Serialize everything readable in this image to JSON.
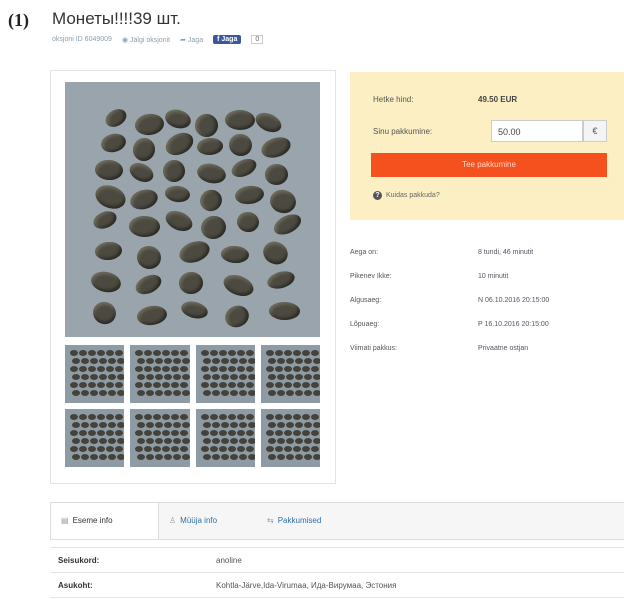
{
  "figure_label": "(1)",
  "listing": {
    "title": "Монеты!!!!39 шт.",
    "meta": {
      "item_id": "oksjoni ID 6049009",
      "watch": "Jälgi oksjonit",
      "share": "Jaga",
      "fb_label": "Jaga",
      "fb_count": "0"
    }
  },
  "bid": {
    "current_price_label": "Hetke hind:",
    "current_price_value": "49.50 EUR",
    "your_bid_label": "Sinu pakkumine:",
    "your_bid_value": "50.00",
    "currency": "€",
    "bid_button": "Tee pakkumine",
    "how_link": "Kuidas pakkuda?"
  },
  "auction_info": [
    {
      "label": "Aega on:",
      "value": "8 tundi, 46 minutit"
    },
    {
      "label": "Pikenev Ikke:",
      "value": "10 minutit"
    },
    {
      "label": "Algusaeg:",
      "value": "N 06.10.2016 20:15:00"
    },
    {
      "label": "Lõpuaeg:",
      "value": "P 16.10.2016 20:15:00"
    },
    {
      "label": "Viimati pakkus:",
      "value": "Privaatne ostjan"
    }
  ],
  "tabs": [
    {
      "label": "Eseme info",
      "icon": "info-icon"
    },
    {
      "label": "Müüja info",
      "icon": "user-icon"
    },
    {
      "label": "Pakkumised",
      "icon": "bids-icon"
    }
  ],
  "details": [
    {
      "label": "Seisukord:",
      "value": "anoline"
    },
    {
      "label": "Asukoht:",
      "value": "Kohtla-Järve,Ida-Virumaa, Ида-Вирумаа, Эстония"
    }
  ]
}
